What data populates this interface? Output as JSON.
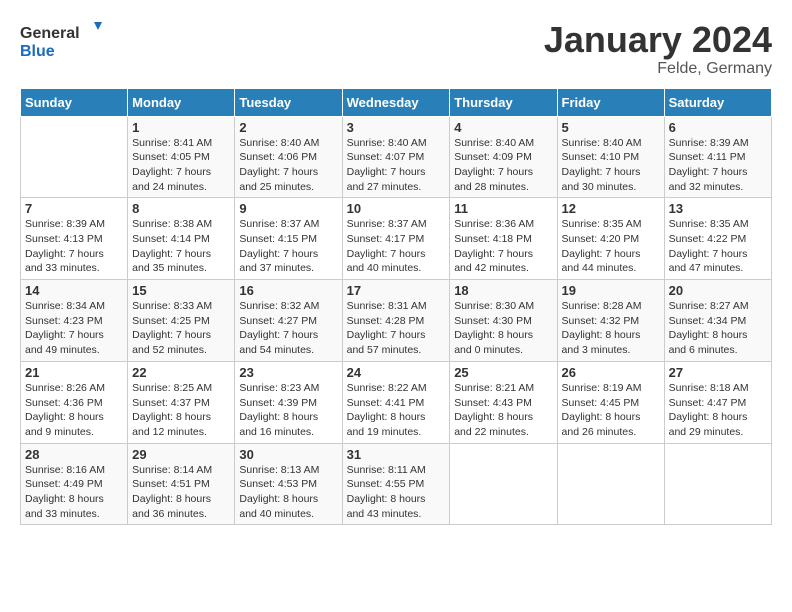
{
  "logo": {
    "general": "General",
    "blue": "Blue"
  },
  "title": "January 2024",
  "location": "Felde, Germany",
  "days_of_week": [
    "Sunday",
    "Monday",
    "Tuesday",
    "Wednesday",
    "Thursday",
    "Friday",
    "Saturday"
  ],
  "weeks": [
    [
      {
        "day": "",
        "sunrise": "",
        "sunset": "",
        "daylight": ""
      },
      {
        "day": "1",
        "sunrise": "Sunrise: 8:41 AM",
        "sunset": "Sunset: 4:05 PM",
        "daylight": "Daylight: 7 hours and 24 minutes."
      },
      {
        "day": "2",
        "sunrise": "Sunrise: 8:40 AM",
        "sunset": "Sunset: 4:06 PM",
        "daylight": "Daylight: 7 hours and 25 minutes."
      },
      {
        "day": "3",
        "sunrise": "Sunrise: 8:40 AM",
        "sunset": "Sunset: 4:07 PM",
        "daylight": "Daylight: 7 hours and 27 minutes."
      },
      {
        "day": "4",
        "sunrise": "Sunrise: 8:40 AM",
        "sunset": "Sunset: 4:09 PM",
        "daylight": "Daylight: 7 hours and 28 minutes."
      },
      {
        "day": "5",
        "sunrise": "Sunrise: 8:40 AM",
        "sunset": "Sunset: 4:10 PM",
        "daylight": "Daylight: 7 hours and 30 minutes."
      },
      {
        "day": "6",
        "sunrise": "Sunrise: 8:39 AM",
        "sunset": "Sunset: 4:11 PM",
        "daylight": "Daylight: 7 hours and 32 minutes."
      }
    ],
    [
      {
        "day": "7",
        "sunrise": "Sunrise: 8:39 AM",
        "sunset": "Sunset: 4:13 PM",
        "daylight": "Daylight: 7 hours and 33 minutes."
      },
      {
        "day": "8",
        "sunrise": "Sunrise: 8:38 AM",
        "sunset": "Sunset: 4:14 PM",
        "daylight": "Daylight: 7 hours and 35 minutes."
      },
      {
        "day": "9",
        "sunrise": "Sunrise: 8:37 AM",
        "sunset": "Sunset: 4:15 PM",
        "daylight": "Daylight: 7 hours and 37 minutes."
      },
      {
        "day": "10",
        "sunrise": "Sunrise: 8:37 AM",
        "sunset": "Sunset: 4:17 PM",
        "daylight": "Daylight: 7 hours and 40 minutes."
      },
      {
        "day": "11",
        "sunrise": "Sunrise: 8:36 AM",
        "sunset": "Sunset: 4:18 PM",
        "daylight": "Daylight: 7 hours and 42 minutes."
      },
      {
        "day": "12",
        "sunrise": "Sunrise: 8:35 AM",
        "sunset": "Sunset: 4:20 PM",
        "daylight": "Daylight: 7 hours and 44 minutes."
      },
      {
        "day": "13",
        "sunrise": "Sunrise: 8:35 AM",
        "sunset": "Sunset: 4:22 PM",
        "daylight": "Daylight: 7 hours and 47 minutes."
      }
    ],
    [
      {
        "day": "14",
        "sunrise": "Sunrise: 8:34 AM",
        "sunset": "Sunset: 4:23 PM",
        "daylight": "Daylight: 7 hours and 49 minutes."
      },
      {
        "day": "15",
        "sunrise": "Sunrise: 8:33 AM",
        "sunset": "Sunset: 4:25 PM",
        "daylight": "Daylight: 7 hours and 52 minutes."
      },
      {
        "day": "16",
        "sunrise": "Sunrise: 8:32 AM",
        "sunset": "Sunset: 4:27 PM",
        "daylight": "Daylight: 7 hours and 54 minutes."
      },
      {
        "day": "17",
        "sunrise": "Sunrise: 8:31 AM",
        "sunset": "Sunset: 4:28 PM",
        "daylight": "Daylight: 7 hours and 57 minutes."
      },
      {
        "day": "18",
        "sunrise": "Sunrise: 8:30 AM",
        "sunset": "Sunset: 4:30 PM",
        "daylight": "Daylight: 8 hours and 0 minutes."
      },
      {
        "day": "19",
        "sunrise": "Sunrise: 8:28 AM",
        "sunset": "Sunset: 4:32 PM",
        "daylight": "Daylight: 8 hours and 3 minutes."
      },
      {
        "day": "20",
        "sunrise": "Sunrise: 8:27 AM",
        "sunset": "Sunset: 4:34 PM",
        "daylight": "Daylight: 8 hours and 6 minutes."
      }
    ],
    [
      {
        "day": "21",
        "sunrise": "Sunrise: 8:26 AM",
        "sunset": "Sunset: 4:36 PM",
        "daylight": "Daylight: 8 hours and 9 minutes."
      },
      {
        "day": "22",
        "sunrise": "Sunrise: 8:25 AM",
        "sunset": "Sunset: 4:37 PM",
        "daylight": "Daylight: 8 hours and 12 minutes."
      },
      {
        "day": "23",
        "sunrise": "Sunrise: 8:23 AM",
        "sunset": "Sunset: 4:39 PM",
        "daylight": "Daylight: 8 hours and 16 minutes."
      },
      {
        "day": "24",
        "sunrise": "Sunrise: 8:22 AM",
        "sunset": "Sunset: 4:41 PM",
        "daylight": "Daylight: 8 hours and 19 minutes."
      },
      {
        "day": "25",
        "sunrise": "Sunrise: 8:21 AM",
        "sunset": "Sunset: 4:43 PM",
        "daylight": "Daylight: 8 hours and 22 minutes."
      },
      {
        "day": "26",
        "sunrise": "Sunrise: 8:19 AM",
        "sunset": "Sunset: 4:45 PM",
        "daylight": "Daylight: 8 hours and 26 minutes."
      },
      {
        "day": "27",
        "sunrise": "Sunrise: 8:18 AM",
        "sunset": "Sunset: 4:47 PM",
        "daylight": "Daylight: 8 hours and 29 minutes."
      }
    ],
    [
      {
        "day": "28",
        "sunrise": "Sunrise: 8:16 AM",
        "sunset": "Sunset: 4:49 PM",
        "daylight": "Daylight: 8 hours and 33 minutes."
      },
      {
        "day": "29",
        "sunrise": "Sunrise: 8:14 AM",
        "sunset": "Sunset: 4:51 PM",
        "daylight": "Daylight: 8 hours and 36 minutes."
      },
      {
        "day": "30",
        "sunrise": "Sunrise: 8:13 AM",
        "sunset": "Sunset: 4:53 PM",
        "daylight": "Daylight: 8 hours and 40 minutes."
      },
      {
        "day": "31",
        "sunrise": "Sunrise: 8:11 AM",
        "sunset": "Sunset: 4:55 PM",
        "daylight": "Daylight: 8 hours and 43 minutes."
      },
      {
        "day": "",
        "sunrise": "",
        "sunset": "",
        "daylight": ""
      },
      {
        "day": "",
        "sunrise": "",
        "sunset": "",
        "daylight": ""
      },
      {
        "day": "",
        "sunrise": "",
        "sunset": "",
        "daylight": ""
      }
    ]
  ]
}
